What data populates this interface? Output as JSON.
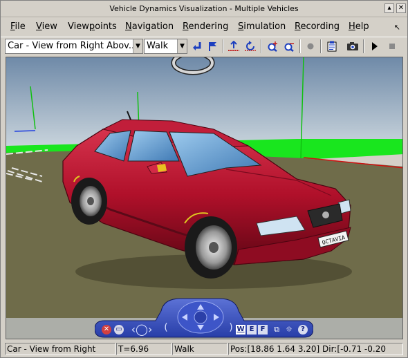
{
  "window": {
    "title": "Vehicle Dynamics Visualization - Multiple Vehicles"
  },
  "menu": {
    "file": {
      "pre": "",
      "key": "F",
      "post": "ile"
    },
    "view": {
      "pre": "",
      "key": "V",
      "post": "iew"
    },
    "viewpoints": {
      "pre": "View",
      "key": "p",
      "post": "oints"
    },
    "navigation": {
      "pre": "",
      "key": "N",
      "post": "avigation"
    },
    "rendering": {
      "pre": "",
      "key": "R",
      "post": "endering"
    },
    "simulation": {
      "pre": "",
      "key": "S",
      "post": "imulation"
    },
    "recording": {
      "pre": "",
      "key": "R",
      "post": "ecording"
    },
    "help": {
      "pre": "",
      "key": "H",
      "post": "elp"
    }
  },
  "toolbar": {
    "viewpoint_select": "Car - View from Right Abov...",
    "nav_mode_select": "Walk"
  },
  "nav_panel": {
    "w": "W",
    "e": "E",
    "f": "F",
    "help": "?"
  },
  "vehicle": {
    "plate": "OCTAVIA"
  },
  "status": {
    "viewpoint": "Car - View from Right",
    "time": "T=6.96",
    "mode": "Walk",
    "position": "Pos:[18.86 1.64 3.20] Dir:[-0.71 -0.20"
  },
  "colors": {
    "sky_top": "#6f8aa8",
    "sky_bottom": "#c9d4dc",
    "grass": "#19e61e",
    "road": "#6f6c4a",
    "car_body": "#b0102a",
    "nav_panel": "#283ea8"
  }
}
